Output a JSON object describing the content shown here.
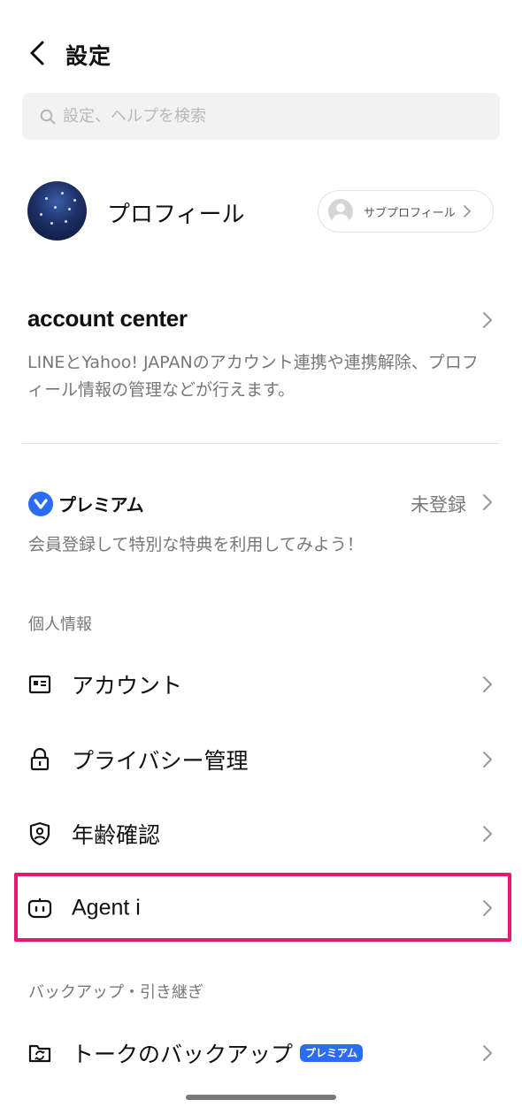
{
  "header": {
    "title": "設定"
  },
  "search": {
    "placeholder": "設定、ヘルプを検索"
  },
  "profile": {
    "name": "プロフィール",
    "subprofile_label": "サブプロフィール"
  },
  "account_center": {
    "title": "account center",
    "description": "LINEとYahoo! JAPANのアカウント連携や連携解除、プロフィール情報の管理などが行えます。"
  },
  "premium": {
    "logo_text": "プレミアム",
    "status": "未登録",
    "description": "会員登録して特別な特典を利用してみよう！"
  },
  "sections": {
    "personal": "個人情報",
    "backup": "バックアップ・引き継ぎ"
  },
  "menu": {
    "account": "アカウント",
    "privacy": "プライバシー管理",
    "age_verification": "年齢確認",
    "agent_i": "Agent i",
    "talk_backup": "トークのバックアップ",
    "talk_backup_badge": "プレミアム"
  },
  "colors": {
    "highlight": "#ee1572",
    "premium_blue": "#2b6cf5"
  },
  "icons": {
    "back": "back-arrow-icon",
    "search": "search-icon",
    "chevron": "chevron-right-icon",
    "account": "id-card-icon",
    "privacy": "lock-icon",
    "age": "shield-user-icon",
    "agent": "robot-face-icon",
    "backup": "folder-sync-icon"
  }
}
